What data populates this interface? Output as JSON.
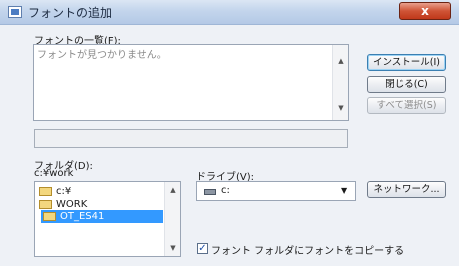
{
  "window": {
    "title": "フォントの追加",
    "close_glyph": "x"
  },
  "font_list": {
    "label": "フォントの一覧(F):",
    "items": [
      "フォントが見つかりません。"
    ]
  },
  "buttons": {
    "install": "インストール(I)",
    "close": "閉じる(C)",
    "select_all": "すべて選択(S)",
    "network": "ネットワーク..."
  },
  "folders": {
    "label": "フォルダ(D):",
    "current_path": "c:¥work",
    "tree": [
      "c:¥",
      "WORK",
      "OT_ES41"
    ]
  },
  "drives": {
    "label": "ドライブ(V):",
    "selected": "c:"
  },
  "copy_option": {
    "label": "フォント フォルダにフォントをコピーする",
    "checked": true
  },
  "colors": {
    "selection": "#3399ff",
    "close_button": "#cf5436"
  }
}
